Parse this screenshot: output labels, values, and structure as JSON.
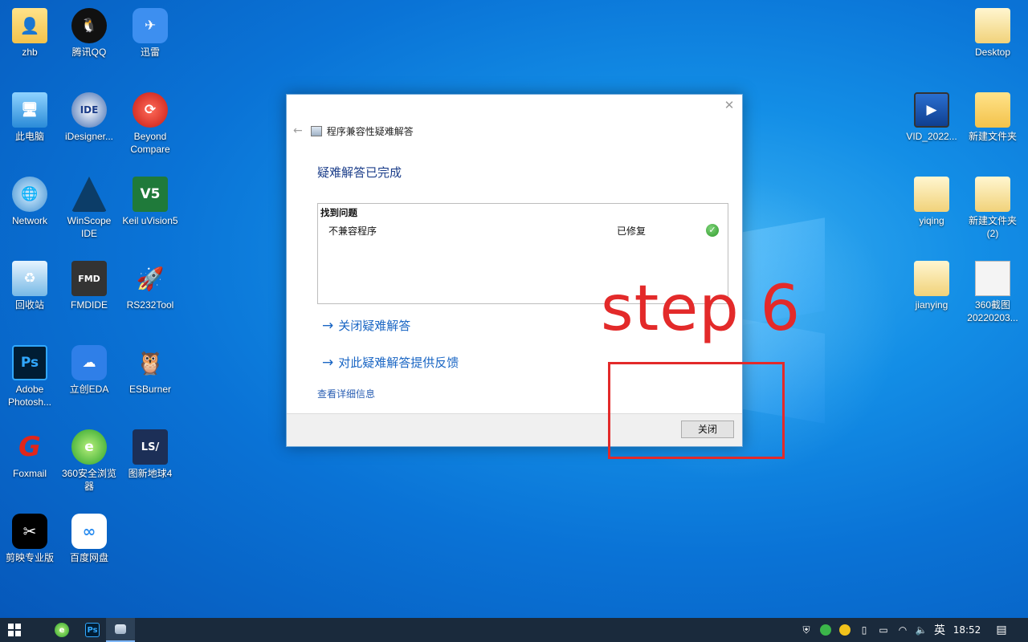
{
  "desktop": {
    "icons_left": [
      {
        "label": "zhb",
        "icon": "user-folder-icon"
      },
      {
        "label": "腾讯QQ",
        "icon": "qq-penguin-icon"
      },
      {
        "label": "迅雷",
        "icon": "thunder-bird-icon"
      },
      {
        "label": "此电脑",
        "icon": "computer-icon"
      },
      {
        "label": "iDesigner...",
        "icon": "ide-disc-icon"
      },
      {
        "label": "Beyond Compare",
        "icon": "compare-icon"
      },
      {
        "label": "Network",
        "icon": "network-globe-icon"
      },
      {
        "label": "WinScope IDE",
        "icon": "winscope-icon"
      },
      {
        "label": "Keil uVision5",
        "icon": "keil-icon"
      },
      {
        "label": "回收站",
        "icon": "recycle-bin-icon"
      },
      {
        "label": "FMDIDE",
        "icon": "chip-icon"
      },
      {
        "label": "RS232Tool",
        "icon": "rocket-icon"
      },
      {
        "label": "Adobe Photosh...",
        "icon": "photoshop-icon"
      },
      {
        "label": "立创EDA",
        "icon": "cloud-eda-icon"
      },
      {
        "label": "ESBurner",
        "icon": "owl-icon"
      },
      {
        "label": "Foxmail",
        "icon": "foxmail-icon"
      },
      {
        "label": "360安全浏览器",
        "icon": "360-browser-icon"
      },
      {
        "label": "图新地球4",
        "icon": "globe4-icon"
      },
      {
        "label": "剪映专业版",
        "icon": "jianying-icon"
      },
      {
        "label": "百度网盘",
        "icon": "baidu-netdisk-icon"
      }
    ],
    "icons_right": [
      {
        "label": "Desktop",
        "icon": "folder-icon"
      },
      {
        "label": "VID_2022...",
        "icon": "video-file-icon"
      },
      {
        "label": "新建文件夹",
        "icon": "folder-icon"
      },
      {
        "label": "yiqing",
        "icon": "folder-icon"
      },
      {
        "label": "新建文件夹 (2)",
        "icon": "folder-icon"
      },
      {
        "label": "jianying",
        "icon": "folder-icon"
      },
      {
        "label": "360截图 20220203...",
        "icon": "screenshot-file-icon"
      }
    ]
  },
  "dialog": {
    "header": "程序兼容性疑难解答",
    "title": "疑难解答已完成",
    "found_heading": "找到问题",
    "issue_name": "不兼容程序",
    "issue_status": "已修复",
    "link_close": "关闭疑难解答",
    "link_feedback": "对此疑难解答提供反馈",
    "detail_link": "查看详细信息",
    "close_button": "关闭"
  },
  "annotation": {
    "text": "step 6",
    "color": "#e32a2a"
  },
  "taskbar": {
    "time": "18:52",
    "ime": "英"
  }
}
